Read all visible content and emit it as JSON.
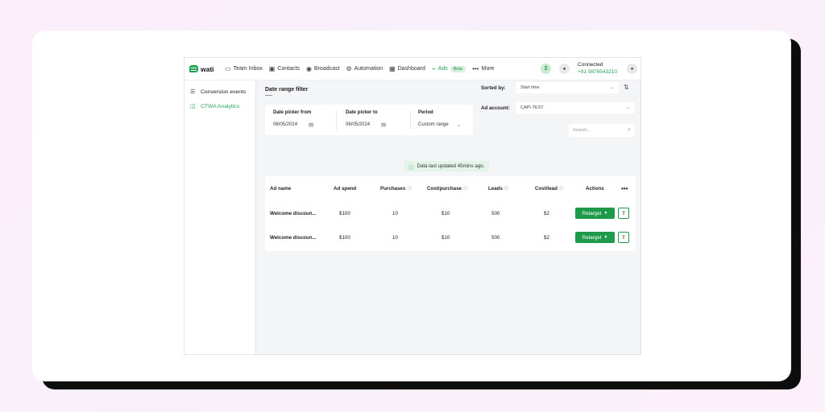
{
  "topnav": {
    "logo_text": "wati",
    "items": [
      {
        "label": "Team Inbox",
        "icon": "inbox-icon"
      },
      {
        "label": "Contacts",
        "icon": "contacts-icon"
      },
      {
        "label": "Broadcast",
        "icon": "broadcast-icon"
      },
      {
        "label": "Automation",
        "icon": "automation-icon"
      },
      {
        "label": "Dashboard",
        "icon": "dashboard-icon"
      },
      {
        "label": "Ads",
        "icon": "ads-icon",
        "badge": "Beta",
        "active": true
      },
      {
        "label": "More",
        "icon": "more-icon"
      }
    ],
    "connection_status": "Connected",
    "phone": "+91 9876543210"
  },
  "sidebar": {
    "items": [
      {
        "label": "Conversion events",
        "icon": "list-icon"
      },
      {
        "label": "CTWA Analytics",
        "icon": "analytics-icon",
        "active": true
      }
    ]
  },
  "filter": {
    "title": "Date range filter",
    "from_label": "Date picker from",
    "from_value": "06/05/2024",
    "to_label": "Date picker to",
    "to_value": "06/05/2024",
    "period_label": "Period",
    "period_value": "Custom range"
  },
  "sort": {
    "label": "Sorted by:",
    "value": "Start time"
  },
  "ad_account": {
    "label": "Ad account:",
    "value": "CAPI-TEST"
  },
  "search": {
    "placeholder": "Search..."
  },
  "status": {
    "updated_text": "Data last updated 45mins ago."
  },
  "table": {
    "headers": {
      "name": "Ad name",
      "spend": "Ad spend",
      "purchases": "Purchases",
      "cost_purchase": "Cost/purchase",
      "leads": "Leads",
      "cost_lead": "Cost/lead",
      "actions": "Actions",
      "more": "•••"
    },
    "rows": [
      {
        "name": "Welcome discoun...",
        "spend": "$100",
        "purchases": "10",
        "cost_purchase": "$10",
        "leads": "500",
        "cost_lead": "$2",
        "action_label": "Retarget"
      },
      {
        "name": "Welcome discoun...",
        "spend": "$100",
        "purchases": "10",
        "cost_purchase": "$10",
        "leads": "500",
        "cost_lead": "$2",
        "action_label": "Retarget"
      }
    ]
  },
  "colors": {
    "brand": "#23a455",
    "button": "#1e9a4a",
    "background_pink": "#fbeefb"
  }
}
